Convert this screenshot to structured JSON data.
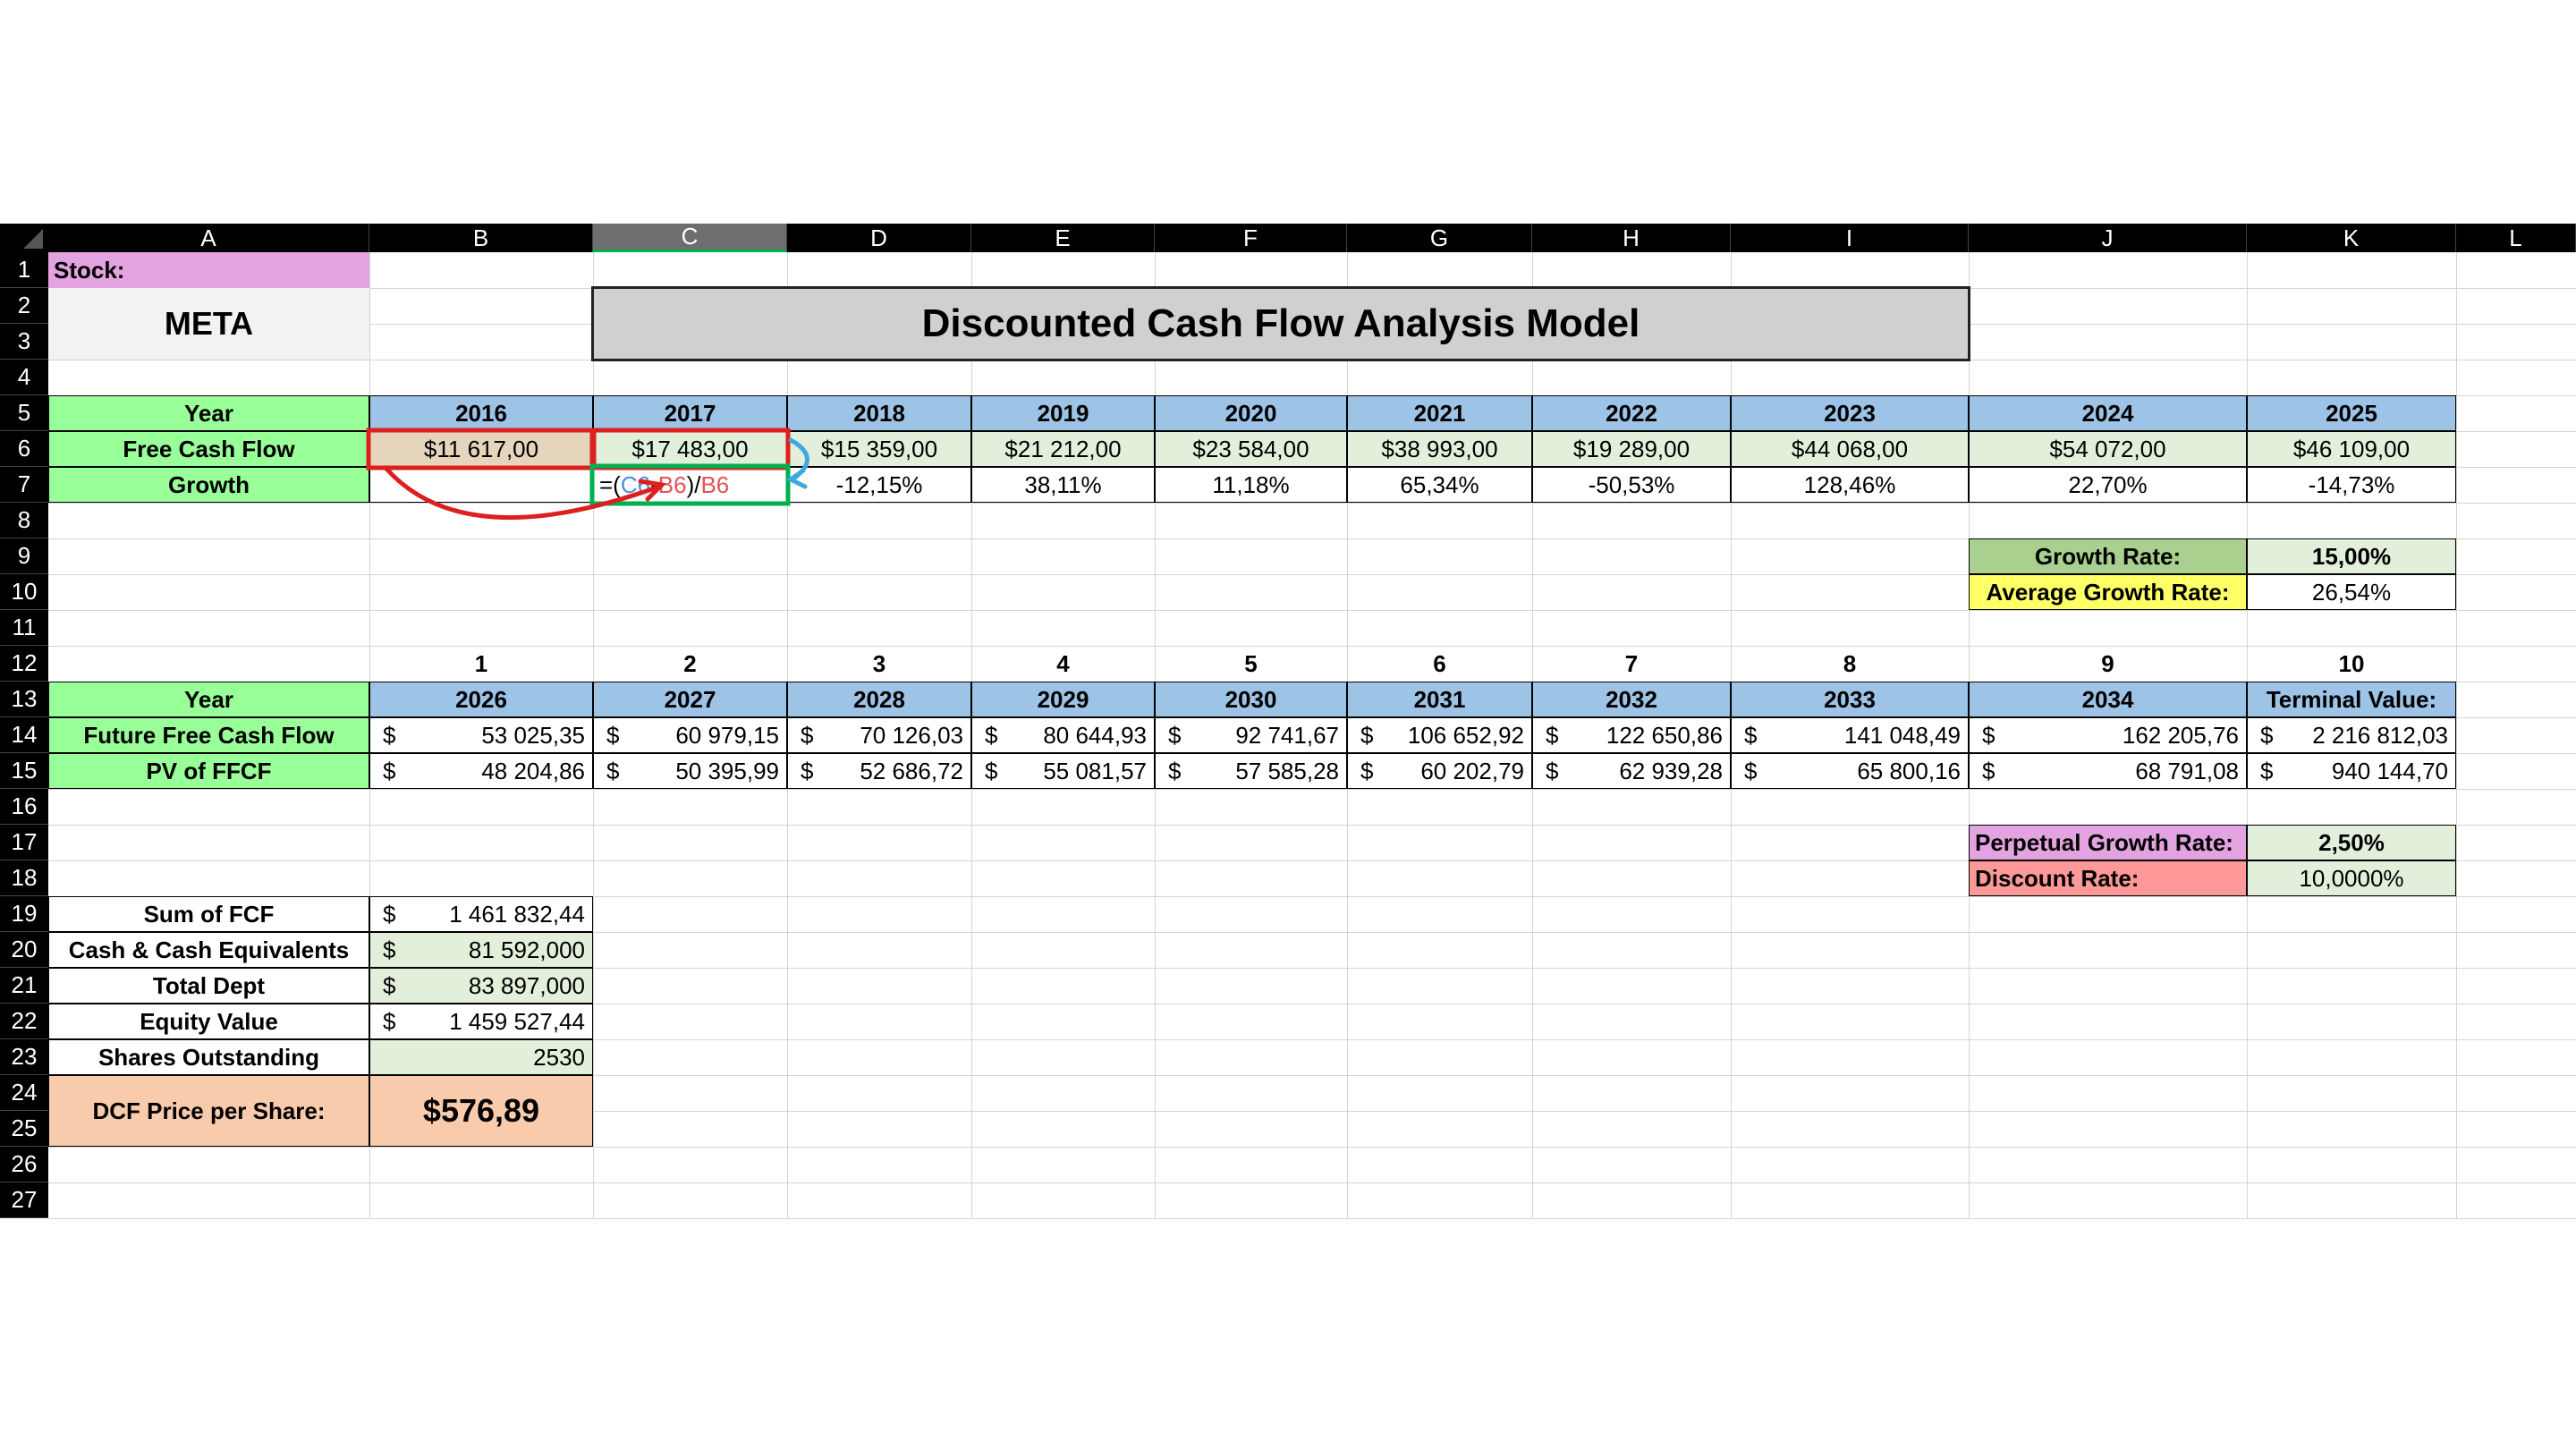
{
  "columns": [
    "A",
    "B",
    "C",
    "D",
    "E",
    "F",
    "G",
    "H",
    "I",
    "J",
    "K",
    "L"
  ],
  "rows": [
    "1",
    "2",
    "3",
    "4",
    "5",
    "6",
    "7",
    "8",
    "9",
    "10",
    "11",
    "12",
    "13",
    "14",
    "15",
    "16",
    "17",
    "18",
    "19",
    "20",
    "21",
    "22",
    "23",
    "24",
    "25",
    "26",
    "27"
  ],
  "stock_label": "Stock:",
  "ticker": "META",
  "title": "Discounted Cash Flow Analysis Model",
  "history": {
    "year_label": "Year",
    "fcf_label": "Free Cash Flow",
    "growth_label": "Growth",
    "years": [
      "2016",
      "2017",
      "2018",
      "2019",
      "2020",
      "2021",
      "2022",
      "2023",
      "2024",
      "2025"
    ],
    "fcf": [
      "$11 617,00",
      "$17 483,00",
      "$15 359,00",
      "$21 212,00",
      "$23 584,00",
      "$38 993,00",
      "$19 289,00",
      "$44 068,00",
      "$54 072,00",
      "$46 109,00"
    ],
    "growth": [
      "",
      "",
      "-12,15%",
      "38,11%",
      "11,18%",
      "65,34%",
      "-50,53%",
      "128,46%",
      "22,70%",
      "-14,73%"
    ],
    "formula_parts": [
      "=(",
      "C6",
      "-",
      "B6",
      ")/",
      "B6"
    ]
  },
  "rates": {
    "growth_rate_label": "Growth Rate:",
    "growth_rate": "15,00%",
    "avg_growth_label": "Average Growth Rate:",
    "avg_growth": "26,54%",
    "perpetual_label": "Perpetual Growth Rate:",
    "perpetual": "2,50%",
    "discount_label": "Discount Rate:",
    "discount": "10,0000%"
  },
  "projection": {
    "periods": [
      "1",
      "2",
      "3",
      "4",
      "5",
      "6",
      "7",
      "8",
      "9",
      "10"
    ],
    "year_label": "Year",
    "years": [
      "2026",
      "2027",
      "2028",
      "2029",
      "2030",
      "2031",
      "2032",
      "2033",
      "2034",
      "Terminal Value:"
    ],
    "ffcf_label": "Future Free Cash Flow",
    "pv_label": "PV of FFCF",
    "currency": "$",
    "ffcf": [
      "53 025,35",
      "60 979,15",
      "70 126,03",
      "80 644,93",
      "92 741,67",
      "106 652,92",
      "122 650,86",
      "141 048,49",
      "162 205,76",
      "2 216 812,03"
    ],
    "pv": [
      "48 204,86",
      "50 395,99",
      "52 686,72",
      "55 081,57",
      "57 585,28",
      "60 202,79",
      "62 939,28",
      "65 800,16",
      "68 791,08",
      "940 144,70"
    ]
  },
  "summary": {
    "items": [
      {
        "label": "Sum of FCF",
        "currency": "$",
        "value": "1 461 832,44"
      },
      {
        "label": "Cash & Cash Equivalents",
        "currency": "$",
        "value": "81 592,000"
      },
      {
        "label": "Total Dept",
        "currency": "$",
        "value": "83 897,000"
      },
      {
        "label": "Equity Value",
        "currency": "$",
        "value": "1 459 527,44"
      },
      {
        "label": "Shares Outstanding",
        "currency": "",
        "value": "2530"
      }
    ],
    "dcf_label": "DCF Price per Share:",
    "dcf_value": "$576,89"
  },
  "colors": {
    "green_label": "#99ff99",
    "blue_header": "#9dc3e6",
    "light_green": "#e2efda",
    "pink": "#e3a3e0",
    "yellow": "#ffff66",
    "salmon": "#f8cbad",
    "red_rate": "#ff9999",
    "annotation_red": "#dd1f1f",
    "annotation_green": "#00b050",
    "annotation_blue": "#40a8e0"
  }
}
